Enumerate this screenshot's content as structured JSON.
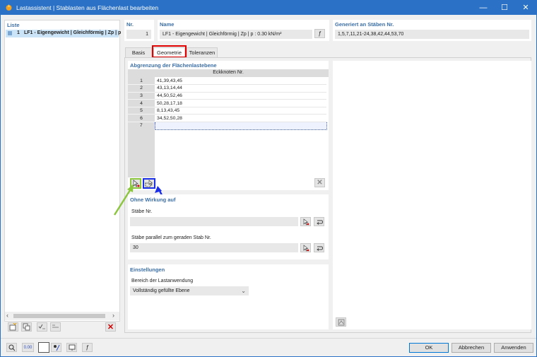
{
  "window": {
    "title": "Lastassistent | Stablasten aus Flächenlast bearbeiten",
    "minimize": "—",
    "maximize": "☐",
    "close": "✕"
  },
  "liste": {
    "header": "Liste",
    "items": [
      {
        "number": "1",
        "text": "LF1 - Eigengewicht | Gleichförmig | Zp | p"
      }
    ]
  },
  "top": {
    "nr_label": "Nr.",
    "nr_value": "1",
    "name_label": "Name",
    "name_value": "LF1 - Eigengewicht | Gleichförmig | Zp | p : 0.30 kN/m²",
    "generated_label": "Generiert an Stäben Nr.",
    "generated_value": "1,5,7,11,21-24,38,42,44,53,70"
  },
  "tabs": [
    {
      "label": "Basis"
    },
    {
      "label": "Geometrie"
    },
    {
      "label": "Toleranzen"
    }
  ],
  "abgrenzung": {
    "header": "Abgrenzung der Flächenlastebene",
    "column_header": "Eckknoten Nr.",
    "rows": [
      {
        "n": "1",
        "value": "41,39,43,45"
      },
      {
        "n": "2",
        "value": "43,13,14,44"
      },
      {
        "n": "3",
        "value": "44,50,52,46"
      },
      {
        "n": "4",
        "value": "50,28,17,18"
      },
      {
        "n": "5",
        "value": "8,13,43,45"
      },
      {
        "n": "6",
        "value": "34,52,50,28"
      },
      {
        "n": "7",
        "value": ""
      }
    ]
  },
  "ohne_wirkung": {
    "header": "Ohne Wirkung auf",
    "staebe_label": "Stäbe Nr.",
    "staebe_value": "",
    "parallel_label": "Stäbe parallel zum geraden Stab Nr.",
    "parallel_value": "30"
  },
  "einstellungen": {
    "header": "Einstellungen",
    "bereich_label": "Bereich der Lastanwendung",
    "bereich_value": "Vollständig gefüllte Ebene"
  },
  "buttons": {
    "ok": "OK",
    "cancel": "Abbrechen",
    "apply": "Anwenden"
  },
  "colors": {
    "title_bar": "#2b71c5",
    "highlight_red": "#e00000",
    "arrow_green": "#8cc63f",
    "arrow_blue": "#1a2ee6"
  }
}
